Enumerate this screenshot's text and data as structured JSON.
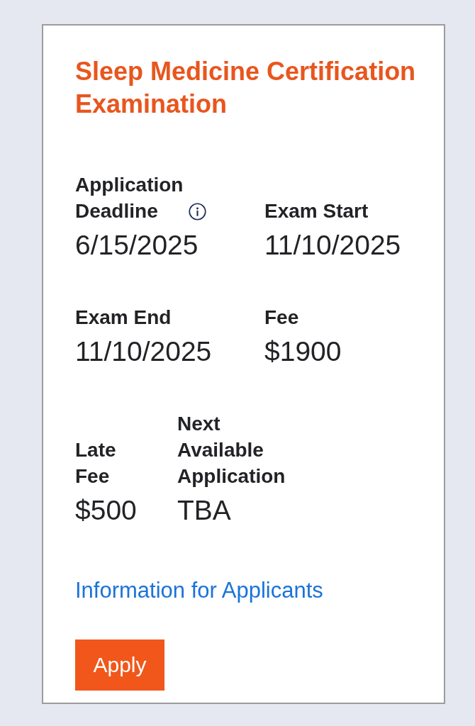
{
  "card": {
    "title": "Sleep Medicine Certification Examination",
    "detail_rows": [
      [
        {
          "label": "Application Deadline",
          "info": true,
          "value": "6/15/2025"
        },
        {
          "label": "Exam Start",
          "info": false,
          "value": "11/10/2025"
        }
      ],
      [
        {
          "label": "Exam End",
          "info": false,
          "value": "11/10/2025"
        },
        {
          "label": "Fee",
          "info": false,
          "value": "$1900"
        }
      ],
      [
        {
          "label": "Late Fee",
          "info": false,
          "value": "$500"
        },
        {
          "label": "Next Available Application",
          "info": false,
          "value": "TBA"
        }
      ]
    ],
    "link": "Information for Applicants",
    "button": "Apply"
  }
}
